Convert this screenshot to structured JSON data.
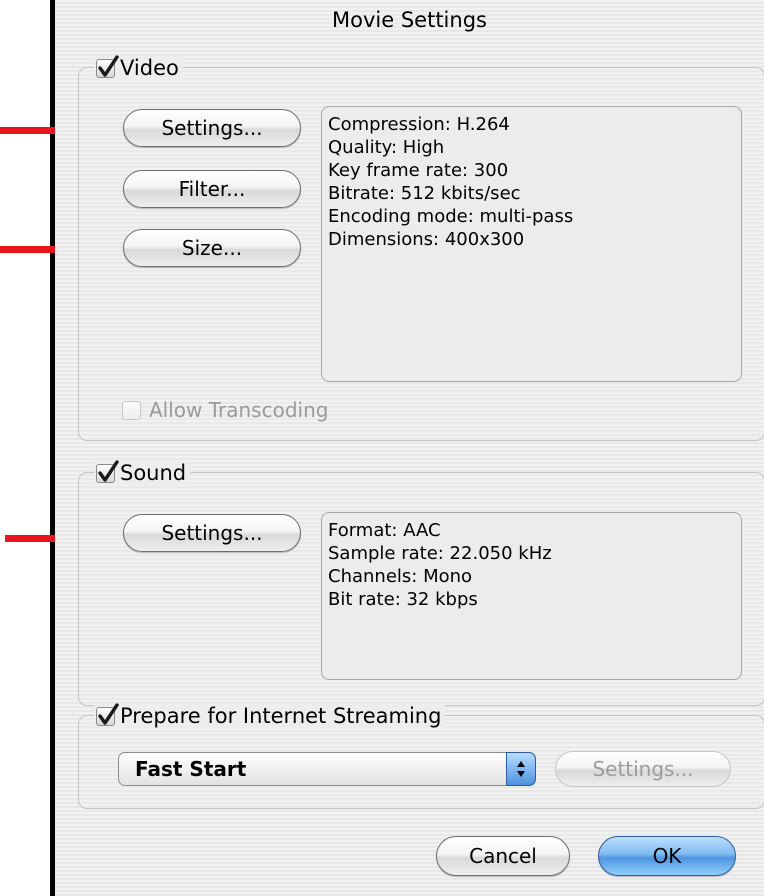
{
  "window": {
    "title": "Movie Settings"
  },
  "video": {
    "label": "Video",
    "checked": true,
    "settings_button": "Settings...",
    "filter_button": "Filter...",
    "size_button": "Size...",
    "info": [
      "Compression: H.264",
      "Quality: High",
      "Key frame rate: 300",
      "Bitrate: 512 kbits/sec",
      "Encoding mode: multi-pass",
      "Dimensions: 400x300"
    ],
    "allow_transcoding_label": "Allow Transcoding",
    "allow_transcoding_checked": false
  },
  "sound": {
    "label": "Sound",
    "checked": true,
    "settings_button": "Settings...",
    "info": [
      "Format: AAC",
      "Sample rate: 22.050 kHz",
      "Channels: Mono",
      "Bit rate: 32 kbps"
    ]
  },
  "streaming": {
    "label": "Prepare for Internet Streaming",
    "checked": true,
    "selected_option": "Fast Start",
    "settings_button": "Settings..."
  },
  "footer": {
    "cancel_button": "Cancel",
    "ok_button": "OK"
  },
  "colors": {
    "annotation_arrow": "#e8161b",
    "default_button": "#4f95df"
  }
}
